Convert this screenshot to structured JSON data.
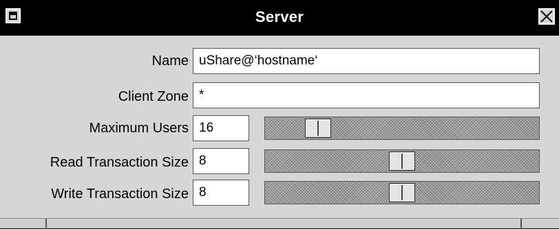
{
  "window": {
    "title": "Server"
  },
  "icons": {
    "window_menu": "window-menu-icon",
    "close": "close-x-icon"
  },
  "fields": {
    "name": {
      "label": "Name",
      "value": "uShare@‘hostname‘"
    },
    "client_zone": {
      "label": "Client Zone",
      "value": "*"
    },
    "max_users": {
      "label": "Maximum Users",
      "value": "16",
      "slider_level": 0.16
    },
    "read_tx": {
      "label": "Read Transaction Size",
      "value": "8",
      "slider_level": 0.5
    },
    "write_tx": {
      "label": "Write Transaction Size",
      "value": "8",
      "slider_level": 0.5
    }
  }
}
